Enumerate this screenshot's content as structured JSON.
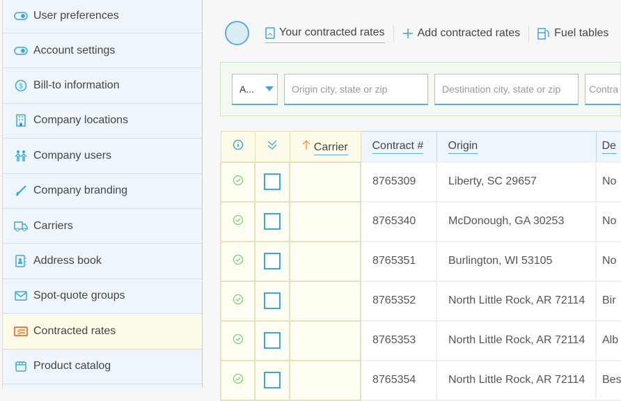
{
  "sidebar": {
    "items": [
      {
        "label": "User preferences",
        "icon": "toggle-icon"
      },
      {
        "label": "Account settings",
        "icon": "toggle-icon"
      },
      {
        "label": "Bill-to information",
        "icon": "dollar-circle-icon"
      },
      {
        "label": "Company locations",
        "icon": "building-icon"
      },
      {
        "label": "Company users",
        "icon": "users-icon"
      },
      {
        "label": "Company branding",
        "icon": "brush-icon"
      },
      {
        "label": "Carriers",
        "icon": "truck-icon"
      },
      {
        "label": "Address book",
        "icon": "contact-book-icon"
      },
      {
        "label": "Spot-quote groups",
        "icon": "envelope-icon"
      },
      {
        "label": "Contracted rates",
        "icon": "rate-card-icon",
        "active": true
      },
      {
        "label": "Product catalog",
        "icon": "box-icon"
      }
    ]
  },
  "tabs": [
    {
      "label": "Your contracted rates",
      "active": true
    },
    {
      "label": "Add contracted rates"
    },
    {
      "label": "Fuel tables"
    }
  ],
  "filter": {
    "select_value": "A...",
    "origin_placeholder": "Origin city, state or zip",
    "destination_placeholder": "Destination city, state or zip",
    "contract_placeholder": "Contra"
  },
  "table": {
    "headers": {
      "carrier": "Carrier",
      "contract": "Contract #",
      "origin": "Origin",
      "destination": "De"
    },
    "rows": [
      {
        "contract": "8765309",
        "origin": "Liberty, SC 29657",
        "destination": "No"
      },
      {
        "contract": "8765340",
        "origin": "McDonough, GA 30253",
        "destination": "No"
      },
      {
        "contract": "8765351",
        "origin": "Burlington, WI 53105",
        "destination": "No"
      },
      {
        "contract": "8765352",
        "origin": "North Little Rock, AR 72114",
        "destination": "Bir"
      },
      {
        "contract": "8765353",
        "origin": "North Little Rock, AR 72114",
        "destination": "Alb"
      },
      {
        "contract": "8765354",
        "origin": "North Little Rock, AR 72114",
        "destination": "Bes"
      }
    ]
  },
  "colors": {
    "accent": "#3ea7d5",
    "active_tab_underline": "#f39a5c",
    "status_ok": "#7dcf7d"
  }
}
